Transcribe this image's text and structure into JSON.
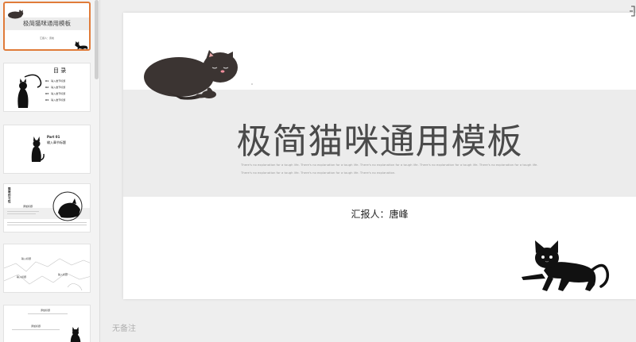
{
  "thumbnails": [
    {
      "title": "极简猫咪通用模板",
      "sub": "汇报人：唐峰"
    },
    {
      "title": "目 录",
      "items": [
        {
          "num": "01",
          "text": "输入章节标题"
        },
        {
          "num": "02",
          "text": "输入章节标题"
        },
        {
          "num": "03",
          "text": "输入章节标题"
        },
        {
          "num": "04",
          "text": "输入章节标题"
        }
      ]
    },
    {
      "part": "Part 01",
      "heading": "输入章节标题"
    },
    {
      "vertical": "猫咪的习性",
      "heading": "添加标题"
    },
    {
      "labels": [
        "输入标题",
        "输入标题",
        "输入标题"
      ]
    },
    {
      "labels": [
        "添加标题",
        "添加标题"
      ]
    }
  ],
  "slide": {
    "title": "极简猫咪通用模板",
    "tagline1": "There's no explanation for a tough life. There's no explanation for a tough life. There's no explanation for a tough life. There's no explanation for a tough life. There's no explanation for a tough life.",
    "tagline2": "There's no explanation for a tough life. There's no explanation for a tough life. There's no explanation.",
    "reporter": "汇报人：唐峰"
  },
  "notes_placeholder": "无备注",
  "colors": {
    "accent": "#e07b39",
    "band": "#ececec",
    "cat_black": "#111111",
    "cat_brown": "#3b3432"
  },
  "icons": [
    "sleeping-cat-illustration",
    "playful-black-cat-illustration",
    "window-edge-icon"
  ]
}
